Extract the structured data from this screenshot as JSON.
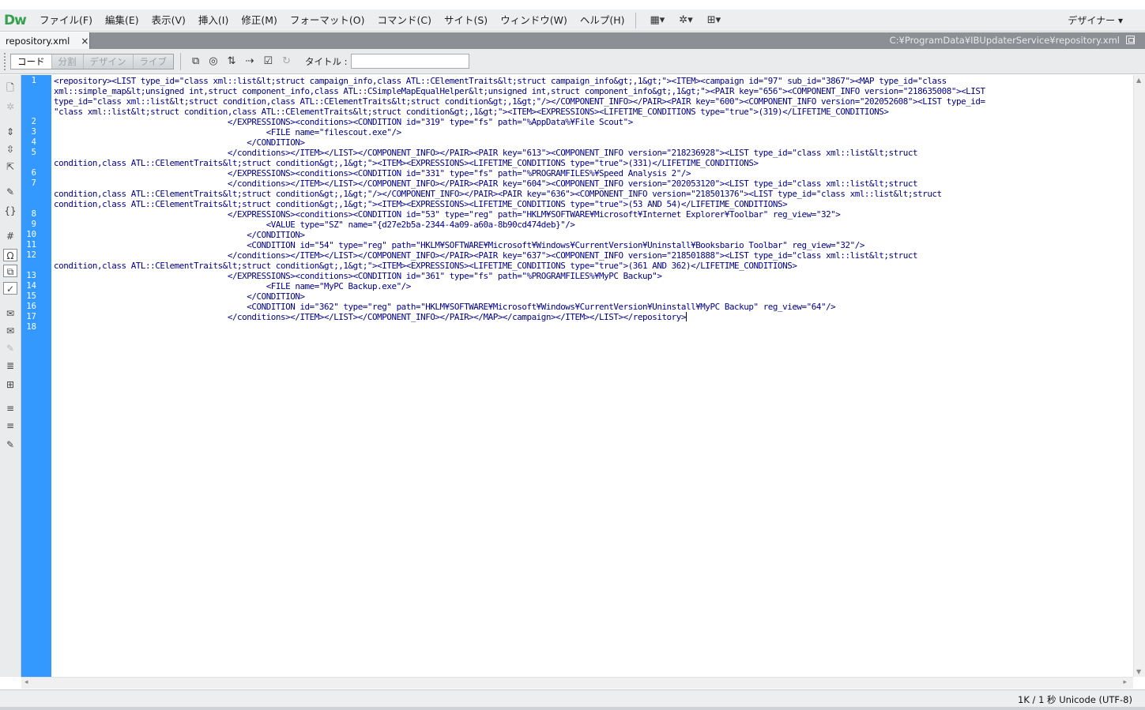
{
  "app": {
    "logo": "Dw"
  },
  "menubar": {
    "items": [
      "ファイル(F)",
      "編集(E)",
      "表示(V)",
      "挿入(I)",
      "修正(M)",
      "フォーマット(O)",
      "コマンド(C)",
      "サイト(S)",
      "ウィンドウ(W)",
      "ヘルプ(H)"
    ],
    "layout_icon": "▦▾",
    "extend_icon": "✲▾",
    "site_icon": "⊞▾",
    "workspace": "デザイナー ▾"
  },
  "document_tab": {
    "name": "repository.xml",
    "close": "×",
    "path": "C:¥ProgramData¥IBUpdaterService¥repository.xml"
  },
  "doc_toolbar": {
    "views": [
      "コード",
      "分割",
      "デザイン",
      "ライブ"
    ],
    "icons": [
      "⧉",
      "◎",
      "⇅",
      "⇢",
      "☑",
      "↻"
    ],
    "title_label": "タイトル :",
    "title_value": ""
  },
  "coding_toolbar": {
    "icons": [
      "🗋",
      "✲",
      "⇕",
      "⇳",
      "⇱",
      "✎",
      "{}",
      "#",
      "Ω",
      "⧉",
      "✓",
      "✉",
      "✉",
      "✎",
      "≣",
      "⊞",
      "≡",
      "≡",
      "✎"
    ]
  },
  "editor": {
    "lines": [
      {
        "n": "1",
        "rows": [
          "<repository><LIST type_id=\"class xml::list&lt;struct campaign_info,class ATL::CElementTraits&lt;struct campaign_info&gt;,1&gt;\"><ITEM><campaign id=\"97\" sub_id=\"3867\"><MAP type_id=\"class",
          "xml::simple_map&lt;unsigned int,struct component_info,class ATL::CSimpleMapEqualHelper&lt;unsigned int,struct component_info&gt;,1&gt;\"><PAIR key=\"656\"><COMPONENT_INFO version=\"218635008\"><LIST",
          "type_id=\"class xml::list&lt;struct condition,class ATL::CElementTraits&lt;struct condition&gt;,1&gt;\"/></COMPONENT_INFO></PAIR><PAIR key=\"600\"><COMPONENT_INFO version=\"202052608\"><LIST type_id=",
          "\"class xml::list&lt;struct condition,class ATL::CElementTraits&lt;struct condition&gt;,1&gt;\"><ITEM><EXPRESSIONS><LIFETIME_CONDITIONS type=\"true\">(319)</LIFETIME_CONDITIONS>"
        ]
      },
      {
        "n": "2",
        "rows": [
          "                                    </EXPRESSIONS><conditions><CONDITION id=\"319\" type=\"fs\" path=\"%AppData%¥File Scout\">"
        ]
      },
      {
        "n": "3",
        "rows": [
          "                                            <FILE name=\"filescout.exe\"/>"
        ]
      },
      {
        "n": "4",
        "rows": [
          "                                        </CONDITION>"
        ]
      },
      {
        "n": "5",
        "rows": [
          "                                    </conditions></ITEM></LIST></COMPONENT_INFO></PAIR><PAIR key=\"613\"><COMPONENT_INFO version=\"218236928\"><LIST type_id=\"class xml::list&lt;struct",
          "condition,class ATL::CElementTraits&lt;struct condition&gt;,1&gt;\"><ITEM><EXPRESSIONS><LIFETIME_CONDITIONS type=\"true\">(331)</LIFETIME_CONDITIONS>"
        ]
      },
      {
        "n": "6",
        "rows": [
          "                                    </EXPRESSIONS><conditions><CONDITION id=\"331\" type=\"fs\" path=\"%PROGRAMFILES%¥Speed Analysis 2\"/>"
        ]
      },
      {
        "n": "7",
        "rows": [
          "                                    </conditions></ITEM></LIST></COMPONENT_INFO></PAIR><PAIR key=\"604\"><COMPONENT_INFO version=\"202053120\"><LIST type_id=\"class xml::list&lt;struct",
          "condition,class ATL::CElementTraits&lt;struct condition&gt;,1&gt;\"/></COMPONENT_INFO></PAIR><PAIR key=\"636\"><COMPONENT_INFO version=\"218501376\"><LIST type_id=\"class xml::list&lt;struct",
          "condition,class ATL::CElementTraits&lt;struct condition&gt;,1&gt;\"><ITEM><EXPRESSIONS><LIFETIME_CONDITIONS type=\"true\">(53 AND 54)</LIFETIME_CONDITIONS>"
        ]
      },
      {
        "n": "8",
        "rows": [
          "                                    </EXPRESSIONS><conditions><CONDITION id=\"53\" type=\"reg\" path=\"HKLM¥SOFTWARE¥Microsoft¥Internet Explorer¥Toolbar\" reg_view=\"32\">"
        ]
      },
      {
        "n": "9",
        "rows": [
          "                                            <VALUE type=\"SZ\" name=\"{d27e2b5a-2344-4a09-a60a-8b90cd474deb}\"/>"
        ]
      },
      {
        "n": "10",
        "rows": [
          "                                        </CONDITION>"
        ]
      },
      {
        "n": "11",
        "rows": [
          "                                        <CONDITION id=\"54\" type=\"reg\" path=\"HKLM¥SOFTWARE¥Microsoft¥Windows¥CurrentVersion¥Uninstall¥Booksbario Toolbar\" reg_view=\"32\"/>"
        ]
      },
      {
        "n": "12",
        "rows": [
          "                                    </conditions></ITEM></LIST></COMPONENT_INFO></PAIR><PAIR key=\"637\"><COMPONENT_INFO version=\"218501888\"><LIST type_id=\"class xml::list&lt;struct",
          "condition,class ATL::CElementTraits&lt;struct condition&gt;,1&gt;\"><ITEM><EXPRESSIONS><LIFETIME_CONDITIONS type=\"true\">(361 AND 362)</LIFETIME_CONDITIONS>"
        ]
      },
      {
        "n": "13",
        "rows": [
          "                                    </EXPRESSIONS><conditions><CONDITION id=\"361\" type=\"fs\" path=\"%PROGRAMFILES%¥MyPC Backup\">"
        ]
      },
      {
        "n": "14",
        "rows": [
          "                                            <FILE name=\"MyPC Backup.exe\"/>"
        ]
      },
      {
        "n": "15",
        "rows": [
          "                                        </CONDITION>"
        ]
      },
      {
        "n": "16",
        "rows": [
          "                                        <CONDITION id=\"362\" type=\"reg\" path=\"HKLM¥SOFTWARE¥Microsoft¥Windows¥CurrentVersion¥Uninstall¥MyPC Backup\" reg_view=\"64\"/>"
        ]
      },
      {
        "n": "17",
        "rows": [
          "                                    </conditions></ITEM></LIST></COMPONENT_INFO></PAIR></MAP></campaign></ITEM></LIST></repository>"
        ]
      },
      {
        "n": "18",
        "rows": [
          ""
        ]
      }
    ]
  },
  "statusbar": {
    "text": "1K / 1 秒  Unicode (UTF-8)"
  }
}
